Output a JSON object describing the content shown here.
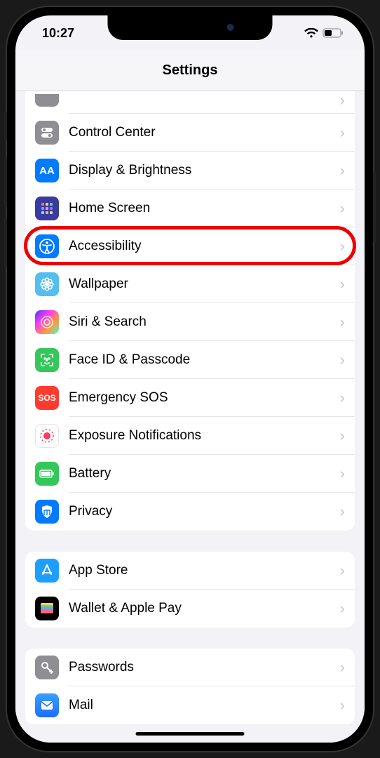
{
  "status": {
    "time": "10:27"
  },
  "header": {
    "title": "Settings"
  },
  "highlight_row_index": 3,
  "sections": [
    {
      "rows": [
        {
          "key": "general-partial",
          "label": "",
          "icon": "gear-icon",
          "partial": true
        },
        {
          "key": "control-center",
          "label": "Control Center",
          "icon": "toggles-icon"
        },
        {
          "key": "display",
          "label": "Display & Brightness",
          "icon": "text-size-icon"
        },
        {
          "key": "home-screen",
          "label": "Home Screen",
          "icon": "grid-icon"
        },
        {
          "key": "accessibility",
          "label": "Accessibility",
          "icon": "accessibility-icon"
        },
        {
          "key": "wallpaper",
          "label": "Wallpaper",
          "icon": "flower-icon"
        },
        {
          "key": "siri",
          "label": "Siri & Search",
          "icon": "siri-icon"
        },
        {
          "key": "faceid",
          "label": "Face ID & Passcode",
          "icon": "faceid-icon"
        },
        {
          "key": "sos",
          "label": "Emergency SOS",
          "icon": "sos-icon",
          "icon_text": "SOS"
        },
        {
          "key": "exposure",
          "label": "Exposure Notifications",
          "icon": "exposure-icon"
        },
        {
          "key": "battery",
          "label": "Battery",
          "icon": "battery-icon"
        },
        {
          "key": "privacy",
          "label": "Privacy",
          "icon": "privacy-icon"
        }
      ]
    },
    {
      "rows": [
        {
          "key": "appstore",
          "label": "App Store",
          "icon": "appstore-icon"
        },
        {
          "key": "wallet",
          "label": "Wallet & Apple Pay",
          "icon": "wallet-icon"
        }
      ]
    },
    {
      "rows": [
        {
          "key": "passwords",
          "label": "Passwords",
          "icon": "key-icon"
        },
        {
          "key": "mail",
          "label": "Mail",
          "icon": "mail-icon"
        }
      ]
    }
  ]
}
